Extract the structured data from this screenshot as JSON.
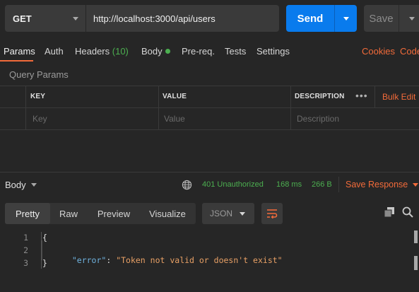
{
  "request": {
    "method": "GET",
    "url": "http://localhost:3000/api/users",
    "send_label": "Send",
    "save_label": "Save"
  },
  "tabs": {
    "params": "Params",
    "auth": "Auth",
    "headers": "Headers",
    "headers_count": "(10)",
    "body": "Body",
    "prereq": "Pre-req.",
    "tests": "Tests",
    "settings": "Settings",
    "cookies": "Cookies",
    "code": "Code"
  },
  "query_params": {
    "title": "Query Params",
    "columns": {
      "key": "KEY",
      "value": "VALUE",
      "description": "DESCRIPTION"
    },
    "more": "•••",
    "bulk_edit": "Bulk Edit",
    "placeholders": {
      "key": "Key",
      "value": "Value",
      "description": "Description"
    }
  },
  "response": {
    "body_label": "Body",
    "status": "401 Unauthorized",
    "time": "168 ms",
    "size": "266 B",
    "save_response": "Save Response",
    "views": [
      "Pretty",
      "Raw",
      "Preview",
      "Visualize"
    ],
    "format": "JSON",
    "code_lines": [
      {
        "n": "1",
        "open": "{"
      },
      {
        "n": "2",
        "key": "\"error\"",
        "sep": ": ",
        "value": "\"Token not valid or doesn't exist\""
      },
      {
        "n": "3",
        "close": "}"
      }
    ]
  },
  "colors": {
    "accent": "#f26b3a",
    "send_blue": "#097bed",
    "success_green": "#4caf50"
  }
}
